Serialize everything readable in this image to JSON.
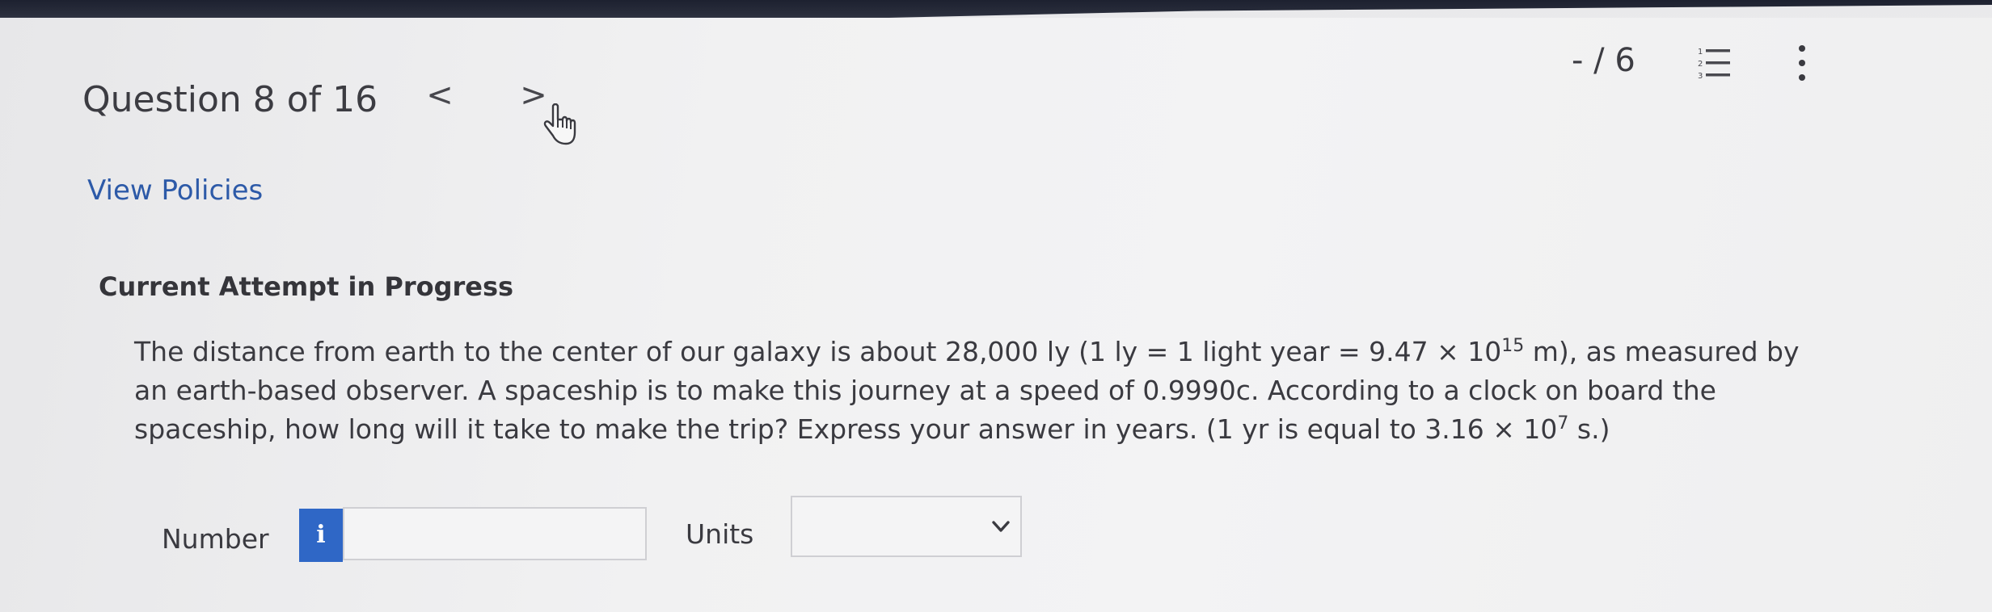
{
  "header": {
    "question_title": "Question 8 of 16",
    "prev_glyph": "<",
    "next_glyph": ">",
    "score": "- / 6",
    "icons": {
      "prev": "chevron-left-icon",
      "next": "chevron-right-icon",
      "list": "numbered-list-icon",
      "more": "more-vertical-icon",
      "cursor": "hand-pointer-icon"
    }
  },
  "links": {
    "view_policies": "View Policies"
  },
  "attempt": {
    "heading": "Current Attempt in Progress"
  },
  "question": {
    "text_a": "The distance from earth to the center of our galaxy is about 28,000 ly (1 ly = 1 light year = 9.47 × 10",
    "sup_a": "15",
    "text_b": " m), as measured by an earth-based observer. A spaceship is to make this journey at a speed of 0.9990c. According to a clock on board the spaceship, how long will it take to make the trip? Express your answer in years. (1 yr is equal to 3.16 × 10",
    "sup_b": "7",
    "text_c": " s.)"
  },
  "answer": {
    "number_label": "Number",
    "info_glyph": "i",
    "number_value": "",
    "units_label": "Units",
    "units_value": ""
  },
  "colors": {
    "link": "#2d5aa8",
    "info_badge": "#2f67c6"
  }
}
